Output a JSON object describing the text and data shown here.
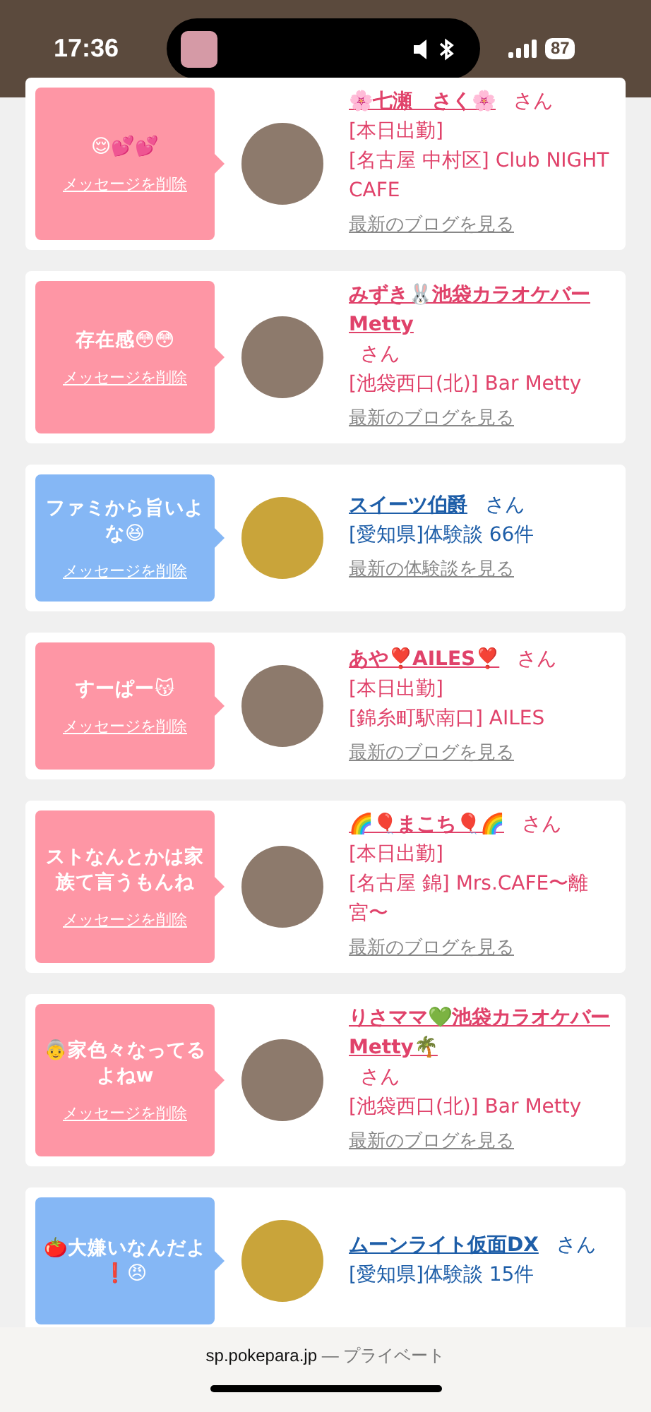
{
  "status_bar": {
    "time": "17:36",
    "battery": "87"
  },
  "cards": [
    {
      "kind": "cast",
      "message": "😌💕💕",
      "delete_label": "メッセージを削除",
      "name": "🌸七瀬　さく🌸",
      "suffix": "さん",
      "status": "[本日出勤]",
      "location": "[名古屋 中村区] Club NIGHT CAFE",
      "link": "最新のブログを見る"
    },
    {
      "kind": "cast",
      "message": "存在感😳😳",
      "delete_label": "メッセージを削除",
      "name": "みずき🐰池袋カラオケバーMetty",
      "suffix": "さん",
      "location": "[池袋西口(北)] Bar Metty",
      "link": "最新のブログを見る"
    },
    {
      "kind": "user",
      "message": "ファミから旨いよな😆",
      "delete_label": "メッセージを削除",
      "name": "スイーツ伯爵",
      "suffix": "さん",
      "location": "[愛知県]体験談 66件",
      "link": "最新の体験談を見る"
    },
    {
      "kind": "cast",
      "message": "すーぱー😽",
      "delete_label": "メッセージを削除",
      "name": "あや❣️AILES❣️",
      "suffix": "さん",
      "status": "[本日出勤]",
      "location": "[錦糸町駅南口] AILES",
      "link": "最新のブログを見る"
    },
    {
      "kind": "cast",
      "message": "ストなんとかは家族て言うもんね",
      "delete_label": "メッセージを削除",
      "name": "🌈🎈まこち🎈🌈",
      "suffix": "さん",
      "status": "[本日出勤]",
      "location": "[名古屋 錦] Mrs.CAFE〜離宮〜",
      "link": "最新のブログを見る"
    },
    {
      "kind": "cast",
      "message": "👵家色々なってるよねw",
      "delete_label": "メッセージを削除",
      "name": "りさママ💚池袋カラオケバーMetty🌴",
      "suffix": "さん",
      "location": "[池袋西口(北)] Bar Metty",
      "link": "最新のブログを見る"
    },
    {
      "kind": "user",
      "message": "🍅大嫌いなんだよ❗️😠",
      "name": "ムーンライト仮面DX",
      "suffix": "さん",
      "location": "[愛知県]体験談 15件"
    }
  ],
  "address_bar": {
    "domain": "sp.pokepara.jp",
    "mode": "— プライベート"
  }
}
